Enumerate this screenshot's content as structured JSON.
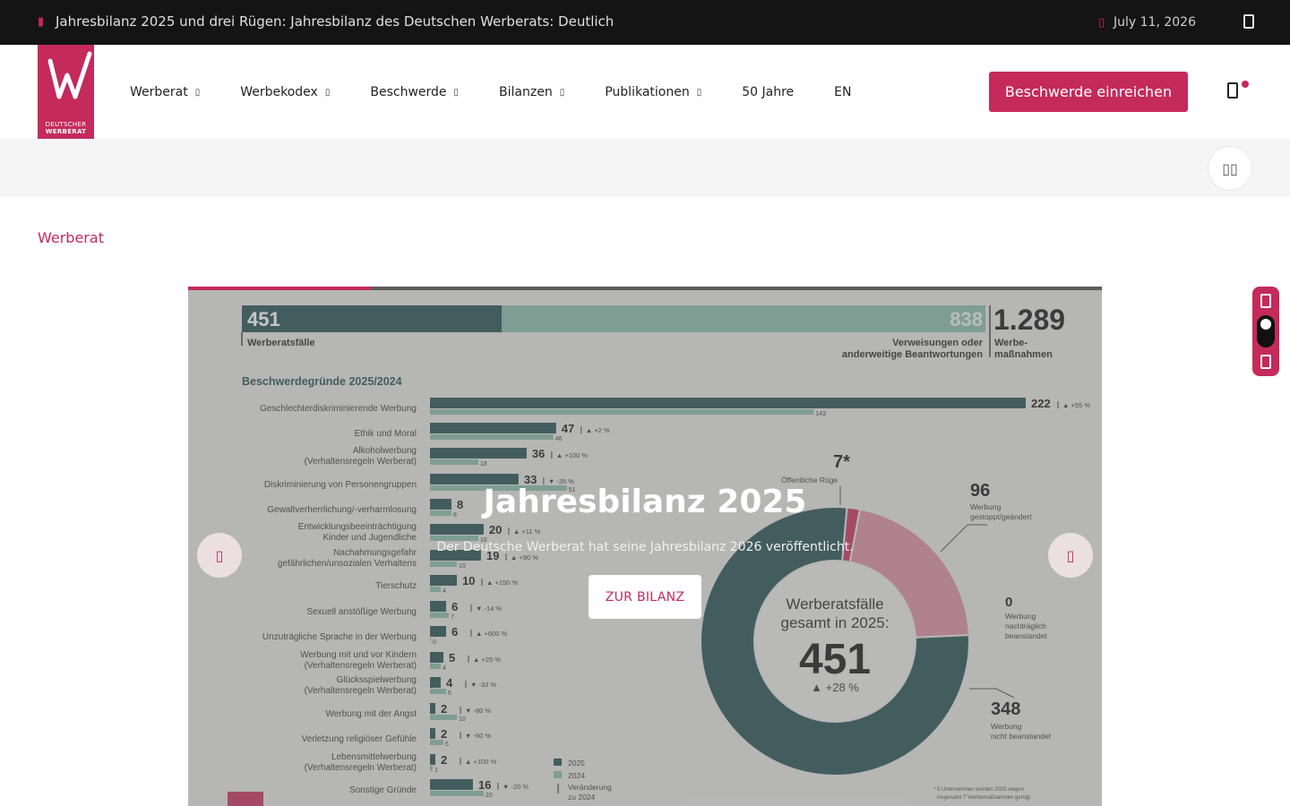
{
  "topbar": {
    "news_text": "Jahresbilanz 2025 und drei Rügen: Jahresbilanz des Deutschen Werberats: Deutlich",
    "date": "July 11, 2026"
  },
  "logo": {
    "line1": "DEUTSCHER",
    "line2": "WERBERAT"
  },
  "nav": {
    "items": [
      {
        "label": "Werberat"
      },
      {
        "label": "Werbekodex"
      },
      {
        "label": "Beschwerde"
      },
      {
        "label": "Bilanzen"
      },
      {
        "label": "Publikationen"
      },
      {
        "label": "50 Jahre"
      },
      {
        "label": "EN"
      }
    ],
    "cta": "Beschwerde einreichen"
  },
  "breadcrumb": "Werberat",
  "slider": {
    "title": "Jahresbilanz 2025",
    "subtitle": "Der Deutsche Werberat hat seine Jahresbilanz 2026 veröffentlicht.",
    "button": "ZUR BILANZ",
    "progress": 0.2
  },
  "infographic": {
    "top": {
      "cases": "451",
      "cases_label": "Werberatsfälle",
      "referrals": "838",
      "referrals_label1": "Verweisungen oder",
      "referrals_label2": "anderweitige Beantwortungen",
      "total": "1.289",
      "total_label1": "Werbe-",
      "total_label2": "maßnahmen"
    },
    "bars_title": "Beschwerdegründe 2025/2024",
    "rows": [
      {
        "l1": "Geschlechterdiskriminierende Werbung",
        "l2": "",
        "v25": 222,
        "v24": 143,
        "chg": "▲ +55 %"
      },
      {
        "l1": "Ethik und Moral",
        "l2": "",
        "v25": 47,
        "v24": 46,
        "chg": "▲ +2 %"
      },
      {
        "l1": "Alkoholwerbung",
        "l2": "(Verhaltensregeln Werberat)",
        "v25": 36,
        "v24": 18,
        "chg": "▲ +100 %"
      },
      {
        "l1": "Diskriminierung von Personengruppen",
        "l2": "",
        "v25": 33,
        "v24": 51,
        "chg": "▼ -35 %"
      },
      {
        "l1": "Gewaltverherrlichung/-verharmlosung",
        "l2": "",
        "v25": 8,
        "v24": 8,
        "chg": ""
      },
      {
        "l1": "Entwicklungsbeeinträchtigung",
        "l2": "Kinder und Jugendliche",
        "v25": 20,
        "v24": 18,
        "chg": "▲ +11 %"
      },
      {
        "l1": "Nachahmungsgefahr",
        "l2": "gefährlichen/unsozialen Verhaltens",
        "v25": 19,
        "v24": 10,
        "chg": "▲ +90 %"
      },
      {
        "l1": "Tierschutz",
        "l2": "",
        "v25": 10,
        "v24": 4,
        "chg": "▲ +150 %"
      },
      {
        "l1": "Sexuell anstößige Werbung",
        "l2": "",
        "v25": 6,
        "v24": 7,
        "chg": "▼ -14 %"
      },
      {
        "l1": "Unzuträgliche Sprache in der Werbung",
        "l2": "",
        "v25": 6,
        "v24": 0,
        "chg": "▲ +600 %"
      },
      {
        "l1": "Werbung mit und vor Kindern",
        "l2": "(Verhaltensregeln Werberat)",
        "v25": 5,
        "v24": 4,
        "chg": "▲ +25 %"
      },
      {
        "l1": "Glücksspielwerbung",
        "l2": "(Verhaltensregeln Werberat)",
        "v25": 4,
        "v24": 6,
        "chg": "▼ -33 %"
      },
      {
        "l1": "Werbung mit der Angst",
        "l2": "",
        "v25": 2,
        "v24": 10,
        "chg": "▼ -80 %"
      },
      {
        "l1": "Verletzung religiöser Gefühle",
        "l2": "",
        "v25": 2,
        "v24": 5,
        "chg": "▼ -60 %"
      },
      {
        "l1": "Lebensmittelwerbung",
        "l2": "(Verhaltensregeln Werberat)",
        "v25": 2,
        "v24": 1,
        "chg": "▲ +100 %"
      },
      {
        "l1": "Sonstige Gründe",
        "l2": "",
        "v25": 16,
        "v24": 20,
        "chg": "▼ -20 %"
      }
    ],
    "legend": {
      "y2025": "2025",
      "y2024": "2024",
      "change1": "Veränderung",
      "change2": "zu 2024"
    },
    "donut": {
      "center1": "Werberatsfälle",
      "center2": "gesamt in 2025:",
      "center_value": "451",
      "center_change": "▲ +28 %",
      "segments": [
        {
          "value": 7,
          "label": "7*",
          "text1": "Öffentliche Rüge",
          "text2": ""
        },
        {
          "value": 96,
          "label": "96",
          "text1": "Werbung",
          "text2": "gestoppt/geändert"
        },
        {
          "value": 0,
          "label": "0",
          "text1": "Werbung",
          "text2": "nachträglich",
          "text3": "beanstandet"
        },
        {
          "value": 348,
          "label": "348",
          "text1": "Werbung",
          "text2": "nicht beanstandet"
        }
      ],
      "footnote1": "* 5 Unternehmen wurden 2025 wegen",
      "footnote2": "insgesamt 7 Werbemaßnahmen gerügt."
    },
    "colors": {
      "dark": "#1e4a4c",
      "light": "#7fb3a2",
      "pink": "#c42a5c",
      "accent": "#c42a5c"
    }
  }
}
